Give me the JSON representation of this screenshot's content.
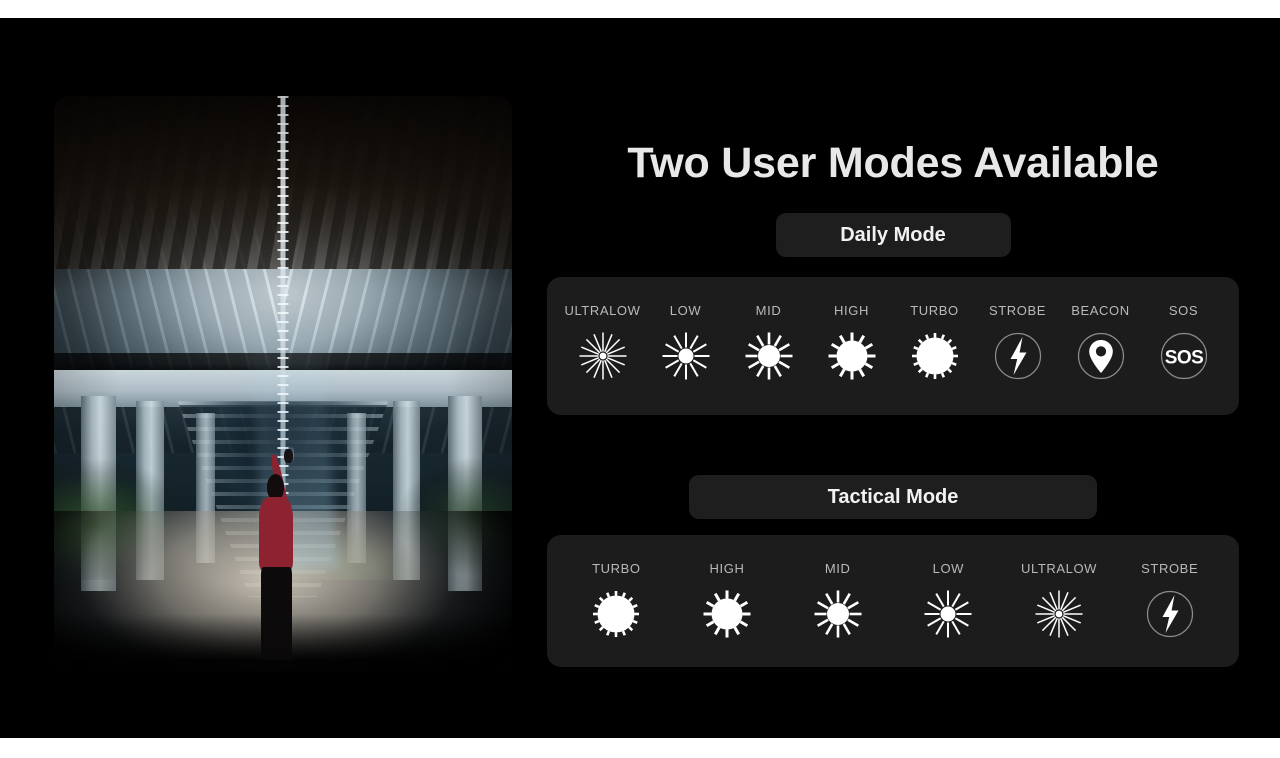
{
  "headline": "Two User Modes Available",
  "colors": {
    "background": "#000000",
    "panel": "#1c1c1c",
    "button": "#1e1e1e",
    "headline_text": "#e8e8e8",
    "label_text": "#b9b9b9",
    "icon": "#ffffff"
  },
  "photo": {
    "alt": "Person in red shirt shining a flashlight upward at the underside of a concrete highway bridge at night"
  },
  "daily": {
    "button_label": "Daily Mode",
    "modes": [
      {
        "label": "ULTRALOW",
        "icon": "sun-ultralow-icon"
      },
      {
        "label": "LOW",
        "icon": "sun-low-icon"
      },
      {
        "label": "MID",
        "icon": "sun-mid-icon"
      },
      {
        "label": "HIGH",
        "icon": "sun-high-icon"
      },
      {
        "label": "TURBO",
        "icon": "sun-turbo-icon"
      },
      {
        "label": "STROBE",
        "icon": "strobe-bolt-icon"
      },
      {
        "label": "BEACON",
        "icon": "beacon-pin-icon"
      },
      {
        "label": "SOS",
        "icon": "sos-icon"
      }
    ]
  },
  "tactical": {
    "button_label": "Tactical Mode",
    "modes": [
      {
        "label": "TURBO",
        "icon": "sun-turbo-icon"
      },
      {
        "label": "HIGH",
        "icon": "sun-high-icon"
      },
      {
        "label": "MID",
        "icon": "sun-mid-icon"
      },
      {
        "label": "LOW",
        "icon": "sun-low-icon"
      },
      {
        "label": "ULTRALOW",
        "icon": "sun-ultralow-icon"
      },
      {
        "label": "STROBE",
        "icon": "strobe-bolt-icon"
      }
    ]
  }
}
